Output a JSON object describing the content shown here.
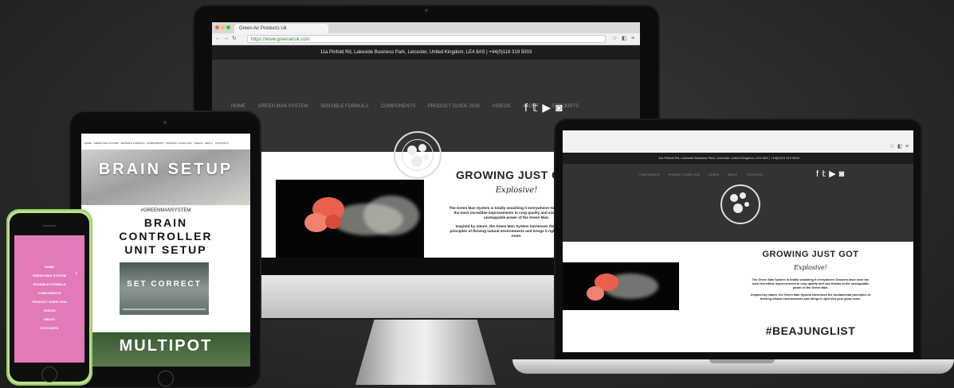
{
  "browser": {
    "tab_title": "Green Air Products Uk",
    "url": "https://www.greenairuk.com"
  },
  "site": {
    "topbar": "11a Pinfold Rd, Lakeside Business Park, Leicester, United Kingdom, LE4 8AS | +44(0)116 319 5003",
    "nav": [
      "HOME",
      "GREEN MAN SYSTEM",
      "SENSIBLE FORMULA",
      "COMPONENTS",
      "PRODUCT GUIDE 2016",
      "VIDEOS",
      "ABOUT",
      "STOCKISTS"
    ],
    "social_icons": [
      "facebook-icon",
      "twitter-icon",
      "youtube-icon",
      "instagram-icon"
    ],
    "social_glyphs": [
      "f",
      "𝕥",
      "▶",
      "◙"
    ],
    "headline": "GROWING JUST GOT",
    "subheadline": "Explosive!",
    "paragraph_1": "The Green Man System is totally smashing it everywhere! Growers have seen the most incredible improvements to crop quality and size thanks to the unstoppable power of the Green Man.",
    "paragraph_2": "Inspired by nature, the Green Man System harnesses the fundamental principles of thriving natural environments and brings it right into your grow room.",
    "hashtag": "#BEAJUNGLIST"
  },
  "ipad": {
    "hero_text": "BRAIN SETUP",
    "hashtag": "#GREENMANSYSTEM",
    "title": "BRAIN CONTROLLER UNIT SETUP",
    "video_text": "SET CORRECT",
    "banner_text": "MULTIPOT"
  },
  "iphone": {
    "menu_items": [
      "HOME",
      "GREEN MAN SYSTEM",
      "SENSIBLE FORMULA",
      "COMPONENTS",
      "PRODUCT GUIDE 2016",
      "VIDEOS",
      "ABOUT",
      "STOCKISTS"
    ],
    "close_glyph": "×"
  },
  "colors": {
    "background": "#2a2a2a",
    "site_header": "#333333",
    "iphone_menu": "#e27ab8",
    "iphone_case": "#b9e58a"
  }
}
